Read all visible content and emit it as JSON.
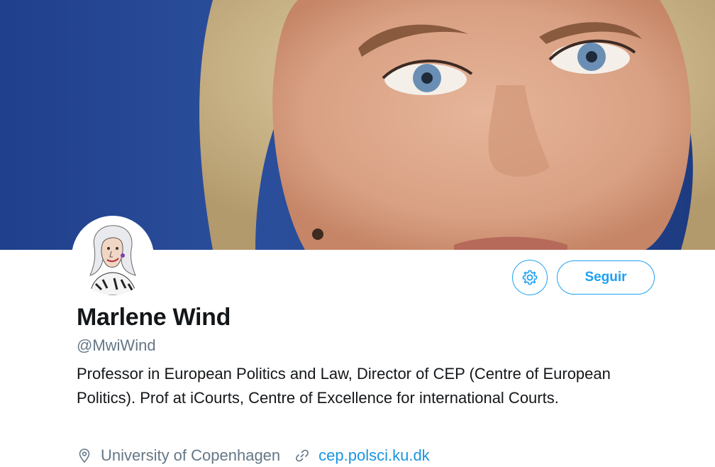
{
  "profile": {
    "name": "Marlene Wind",
    "handle": "@MwiWind",
    "bio": "Professor in European Politics and Law, Director of CEP (Centre of European Politics). Prof at iCourts, Centre of Excellence for international Courts.",
    "location": "University of Copenhagen",
    "website": "cep.polsci.ku.dk"
  },
  "actions": {
    "follow_label": "Seguir",
    "settings_icon": "gear-icon"
  },
  "colors": {
    "accent": "#1da1f2",
    "link": "#1b95e0",
    "secondary_text": "#657786",
    "primary_text": "#14171a",
    "banner_background": "#1f3f8a"
  },
  "icons": {
    "location": "location-pin-icon",
    "website": "link-icon"
  }
}
